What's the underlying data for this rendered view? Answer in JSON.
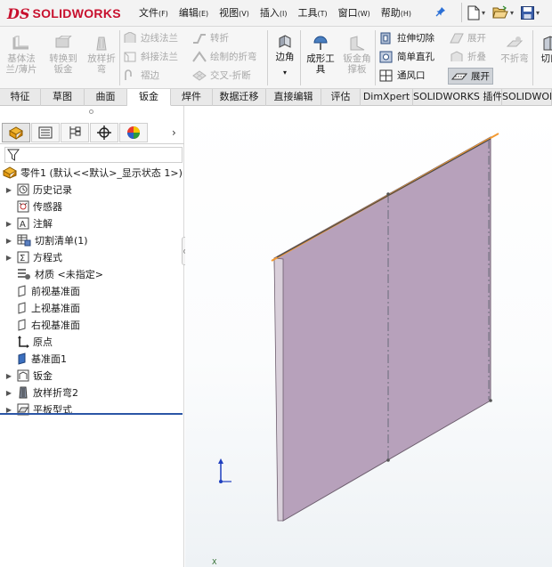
{
  "app": {
    "logo_ds": "DS",
    "logo_text": "SOLIDWORKS"
  },
  "menu": [
    {
      "label": "文件",
      "key": "(F)"
    },
    {
      "label": "编辑",
      "key": "(E)"
    },
    {
      "label": "视图",
      "key": "(V)"
    },
    {
      "label": "插入",
      "key": "(I)"
    },
    {
      "label": "工具",
      "key": "(T)"
    },
    {
      "label": "窗口",
      "key": "(W)"
    },
    {
      "label": "帮助",
      "key": "(H)"
    }
  ],
  "quick_access": {
    "pin_icon": "pin-icon",
    "new_icon": "new-document-icon",
    "open_icon": "open-folder-icon",
    "save_icon": "save-icon"
  },
  "ribbon": {
    "base_flange": "基体法\n兰/薄片",
    "convert_to_sheet": "转换到\n钣金",
    "lofted_bend": "放样折\n弯",
    "edge_flange": "边线法兰",
    "miter_flange": "斜接法兰",
    "hem": "褶边",
    "jog": "转折",
    "sketched_bend": "绘制的折弯",
    "cross_break": "交叉-折断",
    "corner": "边角",
    "forming_tool": "成形工\n具",
    "sheet_gusset": "钣金角\n撑板",
    "extruded_cut": "拉伸切除",
    "simple_hole": "简单直孔",
    "vent": "通风口",
    "unfold": "展开",
    "fold": "折叠",
    "flatten": "展开",
    "no_bends": "不折弯",
    "rip": "切口"
  },
  "tabs": [
    "特征",
    "草图",
    "曲面",
    "钣金",
    "焊件",
    "数据迁移",
    "直接编辑",
    "评估",
    "DimXpert",
    "SOLIDWORKS 插件",
    "SOLIDWORKS MBD"
  ],
  "active_tab": "钣金",
  "panel": {
    "chevron": "›"
  },
  "tree": {
    "root": "零件1  (默认<<默认>_显示状态 1>)",
    "items": [
      {
        "label": "历史记录",
        "expandable": true,
        "icon": "history-icon"
      },
      {
        "label": "传感器",
        "expandable": false,
        "icon": "sensor-icon"
      },
      {
        "label": "注解",
        "expandable": true,
        "icon": "annotation-icon"
      },
      {
        "label": "切割清单(1)",
        "expandable": true,
        "icon": "cut-list-icon"
      },
      {
        "label": "方程式",
        "expandable": true,
        "icon": "equation-icon"
      },
      {
        "label": "材质 <未指定>",
        "expandable": false,
        "icon": "material-icon"
      },
      {
        "label": "前视基准面",
        "expandable": false,
        "icon": "plane-icon"
      },
      {
        "label": "上视基准面",
        "expandable": false,
        "icon": "plane-icon"
      },
      {
        "label": "右视基准面",
        "expandable": false,
        "icon": "plane-icon"
      },
      {
        "label": "原点",
        "expandable": false,
        "icon": "origin-icon"
      },
      {
        "label": "基准面1",
        "expandable": false,
        "icon": "plane-blue-icon"
      },
      {
        "label": "钣金",
        "expandable": true,
        "icon": "sheet-metal-icon"
      },
      {
        "label": "放样折弯2",
        "expandable": true,
        "icon": "lofted-bend-icon"
      },
      {
        "label": "平板型式",
        "expandable": true,
        "icon": "flat-pattern-icon"
      }
    ]
  },
  "viewport": {
    "part_color": "#b7a1bb",
    "edge_color": "#f39a32",
    "triad_label": "Y",
    "bottom_label": "X"
  }
}
